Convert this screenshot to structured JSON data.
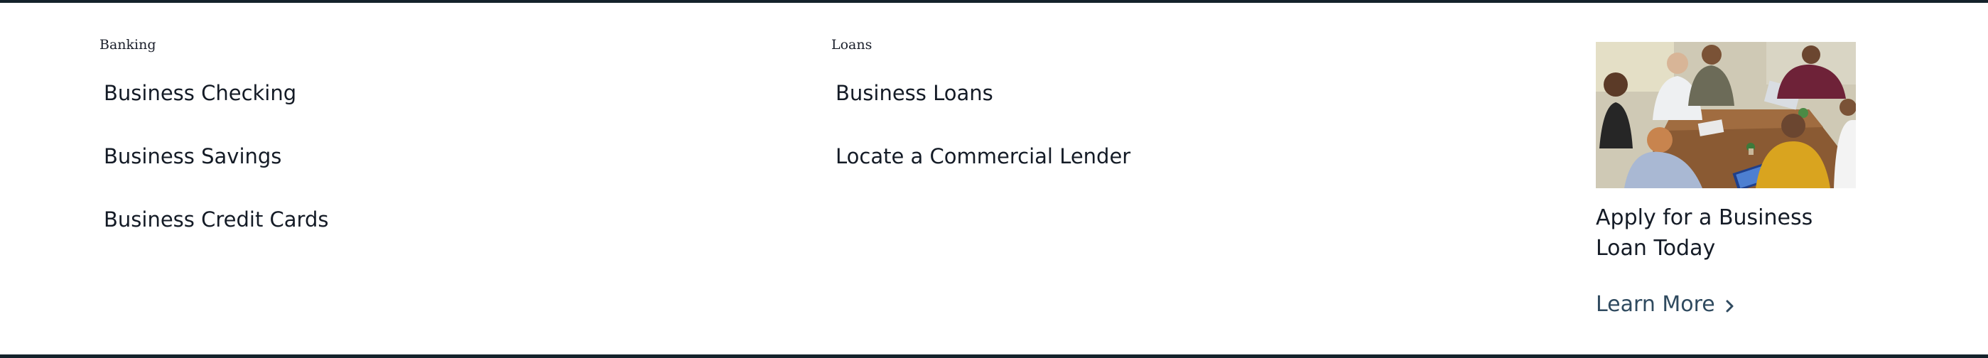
{
  "banking": {
    "heading": "Banking",
    "links": [
      "Business Checking",
      "Business Savings",
      "Business Credit Cards"
    ]
  },
  "loans": {
    "heading": "Loans",
    "links": [
      "Business Loans",
      "Locate a Commercial Lender"
    ]
  },
  "promo": {
    "title": "Apply for a Business Loan Today",
    "link_label": "Learn More",
    "link_icon": "chevron-right-icon"
  },
  "colors": {
    "rule": "#14222b",
    "text": "#141b26",
    "link_accent": "#2f4a5f"
  }
}
